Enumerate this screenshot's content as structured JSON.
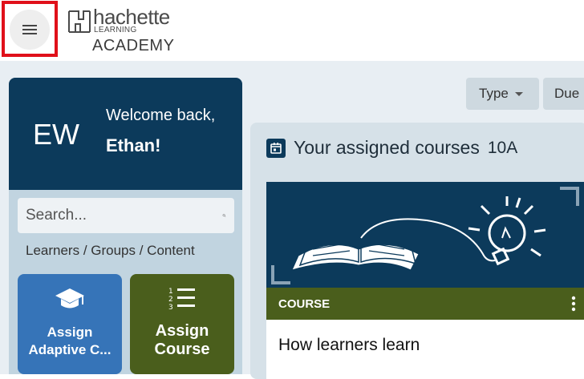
{
  "header": {
    "brand_name": "hachette",
    "brand_sub": "LEARNING",
    "brand_product": "ACADEMY"
  },
  "user": {
    "initials": "EW",
    "welcome": "Welcome back,",
    "name": "Ethan!"
  },
  "search": {
    "placeholder": "Search..."
  },
  "filter_links": "Learners / Groups / Content",
  "actions": {
    "adaptive_line1": "Assign",
    "adaptive_line2": "Adaptive C...",
    "course_line1": "Assign",
    "course_line2": "Course"
  },
  "filters": {
    "type_label": "Type",
    "due_label": "Due"
  },
  "courses": {
    "title": "Your assigned courses",
    "group": "10A",
    "card": {
      "type": "COURSE",
      "title": "How learners learn"
    }
  },
  "colors": {
    "navy": "#0c3a5b",
    "olive": "#4a5e1c",
    "blue": "#3674b8",
    "highlight": "#e0101a"
  }
}
